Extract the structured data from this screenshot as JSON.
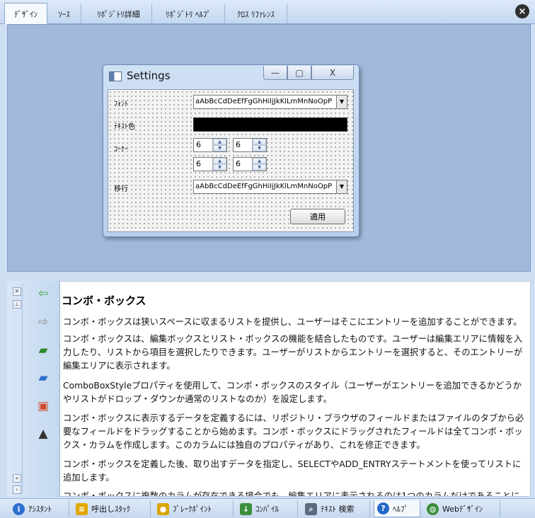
{
  "tabs": [
    {
      "label": "ﾃﾞｻﾞｲﾝ",
      "active": true
    },
    {
      "label": "ｿｰｽ",
      "active": false
    },
    {
      "label": "ﾘﾎﾟｼﾞﾄﾘ詳細",
      "active": false
    },
    {
      "label": "ﾘﾎﾟｼﾞﾄﾘ ﾍﾙﾌﾟ",
      "active": false
    },
    {
      "label": "ｸﾛｽ ﾘﾌｧﾚﾝｽ",
      "active": false
    }
  ],
  "close_icon": "×",
  "dialog": {
    "title": "Settings",
    "min_icon": "—",
    "max_icon": "▢",
    "close_icon": "X",
    "font_label": "ﾌｫﾝﾄ",
    "font_value": "aAbBcCdDeEfFgGhHiIjJkKlLmMnNoOpP",
    "text_color_label": "ﾃｷｽﾄ色",
    "text_color": "#000000",
    "corner_label": "ｺｰﾅｰ",
    "corner_values": [
      "6",
      "6",
      "6",
      "6"
    ],
    "transition_label": "移行",
    "transition_value": "aAbBcCdDeEfFgGhHiIjJkKlLmMnNoOpP",
    "apply_label": "適用",
    "dropdown_icon": "▼",
    "spin_up": "▲",
    "spin_down": "▼"
  },
  "help": {
    "title": "コンボ・ボックス",
    "paragraphs": [
      "コンボ・ボックスは狭いスペースに収まるリストを提供し、ユーザーはそこにエントリーを追加することができます。",
      "コンボ・ボックスは、編集ボックスとリスト・ボックスの機能を結合したものです。ユーザーは編集エリアに情報を入力したり、リストから項目を選択したりできます。ユーザーがリストからエントリーを選択すると、そのエントリーが編集エリアに表示されます。",
      "ComboBoxStyleプロパティを使用して、コンボ・ボックスのスタイル（ユーザーがエントリーを追加できるかどうかやリストがドロップ・ダウンか通常のリストなのか）を設定します。",
      "コンボ・ボックスに表示するデータを定義するには、リポジトリ・ブラウザのフィールドまたはファイルのタブから必要なフィールドをドラッグすることから始めます。コンボ・ボックスにドラッグされたフィールドは全てコンボ・ボックス・カラムを作成します。このカラムには独自のプロパティがあり、これを修正できます。",
      "コンボ・ボックスを定義した後、取り出すデータを指定し、SELECTやADD_ENTRYステートメントを使ってリストに追加します。",
      "コンボ・ボックスに複数のカラムが存在できる場合でも、編集エリアに表示されるのは1つのカラムだけであることに注意してください。"
    ],
    "nav_icons": [
      "back-arrow-icon",
      "forward-arrow-icon",
      "books-icon",
      "book-icon",
      "index-icon",
      "graduation-cap-icon"
    ]
  },
  "bottom_tabs": [
    {
      "label": "ｱｼｽﾀﾝﾄ",
      "icon": "info-icon",
      "color": "#2f6fd0",
      "active": false
    },
    {
      "label": "呼出しｽﾀｯｸ",
      "icon": "stack-icon",
      "color": "#e0a800",
      "active": false
    },
    {
      "label": "ﾌﾞﾚｰｸﾎﾟｲﾝﾄ",
      "icon": "breakpoint-icon",
      "color": "#d9a400",
      "active": false
    },
    {
      "label": "ｺﾝﾊﾟｲﾙ",
      "icon": "compile-icon",
      "color": "#3d8f3d",
      "active": false
    },
    {
      "label": "ﾃｷｽﾄ 検索",
      "icon": "text-search-icon",
      "color": "#5a6a80",
      "active": false
    },
    {
      "label": "ﾍﾙﾌﾟ",
      "icon": "help-icon",
      "color": "#2468c8",
      "active": true
    },
    {
      "label": "Webﾃﾞｻﾞｲﾝ",
      "icon": "web-design-icon",
      "color": "#3b8c3b",
      "active": false
    }
  ]
}
